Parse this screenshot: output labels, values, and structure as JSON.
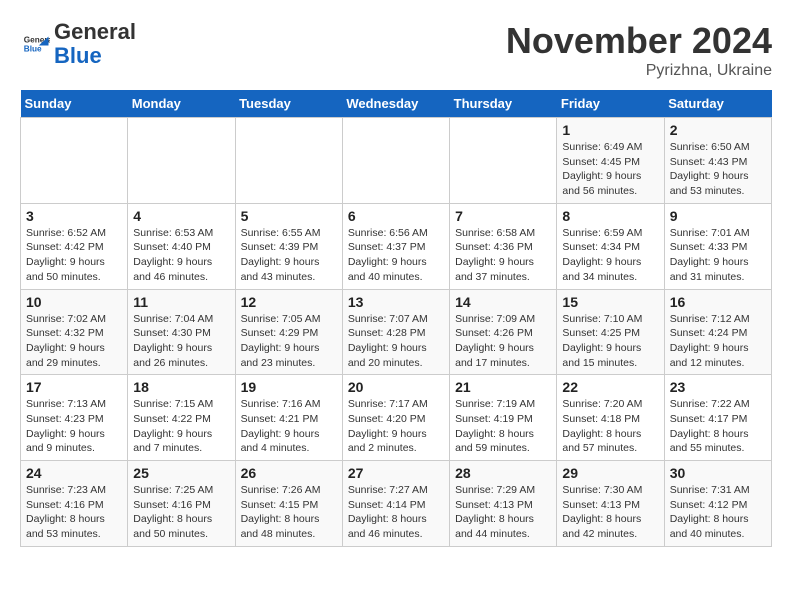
{
  "logo": {
    "general": "General",
    "blue": "Blue"
  },
  "header": {
    "month": "November 2024",
    "location": "Pyrizhna, Ukraine"
  },
  "weekdays": [
    "Sunday",
    "Monday",
    "Tuesday",
    "Wednesday",
    "Thursday",
    "Friday",
    "Saturday"
  ],
  "weeks": [
    [
      {
        "day": "",
        "info": ""
      },
      {
        "day": "",
        "info": ""
      },
      {
        "day": "",
        "info": ""
      },
      {
        "day": "",
        "info": ""
      },
      {
        "day": "",
        "info": ""
      },
      {
        "day": "1",
        "info": "Sunrise: 6:49 AM\nSunset: 4:45 PM\nDaylight: 9 hours and 56 minutes."
      },
      {
        "day": "2",
        "info": "Sunrise: 6:50 AM\nSunset: 4:43 PM\nDaylight: 9 hours and 53 minutes."
      }
    ],
    [
      {
        "day": "3",
        "info": "Sunrise: 6:52 AM\nSunset: 4:42 PM\nDaylight: 9 hours and 50 minutes."
      },
      {
        "day": "4",
        "info": "Sunrise: 6:53 AM\nSunset: 4:40 PM\nDaylight: 9 hours and 46 minutes."
      },
      {
        "day": "5",
        "info": "Sunrise: 6:55 AM\nSunset: 4:39 PM\nDaylight: 9 hours and 43 minutes."
      },
      {
        "day": "6",
        "info": "Sunrise: 6:56 AM\nSunset: 4:37 PM\nDaylight: 9 hours and 40 minutes."
      },
      {
        "day": "7",
        "info": "Sunrise: 6:58 AM\nSunset: 4:36 PM\nDaylight: 9 hours and 37 minutes."
      },
      {
        "day": "8",
        "info": "Sunrise: 6:59 AM\nSunset: 4:34 PM\nDaylight: 9 hours and 34 minutes."
      },
      {
        "day": "9",
        "info": "Sunrise: 7:01 AM\nSunset: 4:33 PM\nDaylight: 9 hours and 31 minutes."
      }
    ],
    [
      {
        "day": "10",
        "info": "Sunrise: 7:02 AM\nSunset: 4:32 PM\nDaylight: 9 hours and 29 minutes."
      },
      {
        "day": "11",
        "info": "Sunrise: 7:04 AM\nSunset: 4:30 PM\nDaylight: 9 hours and 26 minutes."
      },
      {
        "day": "12",
        "info": "Sunrise: 7:05 AM\nSunset: 4:29 PM\nDaylight: 9 hours and 23 minutes."
      },
      {
        "day": "13",
        "info": "Sunrise: 7:07 AM\nSunset: 4:28 PM\nDaylight: 9 hours and 20 minutes."
      },
      {
        "day": "14",
        "info": "Sunrise: 7:09 AM\nSunset: 4:26 PM\nDaylight: 9 hours and 17 minutes."
      },
      {
        "day": "15",
        "info": "Sunrise: 7:10 AM\nSunset: 4:25 PM\nDaylight: 9 hours and 15 minutes."
      },
      {
        "day": "16",
        "info": "Sunrise: 7:12 AM\nSunset: 4:24 PM\nDaylight: 9 hours and 12 minutes."
      }
    ],
    [
      {
        "day": "17",
        "info": "Sunrise: 7:13 AM\nSunset: 4:23 PM\nDaylight: 9 hours and 9 minutes."
      },
      {
        "day": "18",
        "info": "Sunrise: 7:15 AM\nSunset: 4:22 PM\nDaylight: 9 hours and 7 minutes."
      },
      {
        "day": "19",
        "info": "Sunrise: 7:16 AM\nSunset: 4:21 PM\nDaylight: 9 hours and 4 minutes."
      },
      {
        "day": "20",
        "info": "Sunrise: 7:17 AM\nSunset: 4:20 PM\nDaylight: 9 hours and 2 minutes."
      },
      {
        "day": "21",
        "info": "Sunrise: 7:19 AM\nSunset: 4:19 PM\nDaylight: 8 hours and 59 minutes."
      },
      {
        "day": "22",
        "info": "Sunrise: 7:20 AM\nSunset: 4:18 PM\nDaylight: 8 hours and 57 minutes."
      },
      {
        "day": "23",
        "info": "Sunrise: 7:22 AM\nSunset: 4:17 PM\nDaylight: 8 hours and 55 minutes."
      }
    ],
    [
      {
        "day": "24",
        "info": "Sunrise: 7:23 AM\nSunset: 4:16 PM\nDaylight: 8 hours and 53 minutes."
      },
      {
        "day": "25",
        "info": "Sunrise: 7:25 AM\nSunset: 4:16 PM\nDaylight: 8 hours and 50 minutes."
      },
      {
        "day": "26",
        "info": "Sunrise: 7:26 AM\nSunset: 4:15 PM\nDaylight: 8 hours and 48 minutes."
      },
      {
        "day": "27",
        "info": "Sunrise: 7:27 AM\nSunset: 4:14 PM\nDaylight: 8 hours and 46 minutes."
      },
      {
        "day": "28",
        "info": "Sunrise: 7:29 AM\nSunset: 4:13 PM\nDaylight: 8 hours and 44 minutes."
      },
      {
        "day": "29",
        "info": "Sunrise: 7:30 AM\nSunset: 4:13 PM\nDaylight: 8 hours and 42 minutes."
      },
      {
        "day": "30",
        "info": "Sunrise: 7:31 AM\nSunset: 4:12 PM\nDaylight: 8 hours and 40 minutes."
      }
    ]
  ]
}
